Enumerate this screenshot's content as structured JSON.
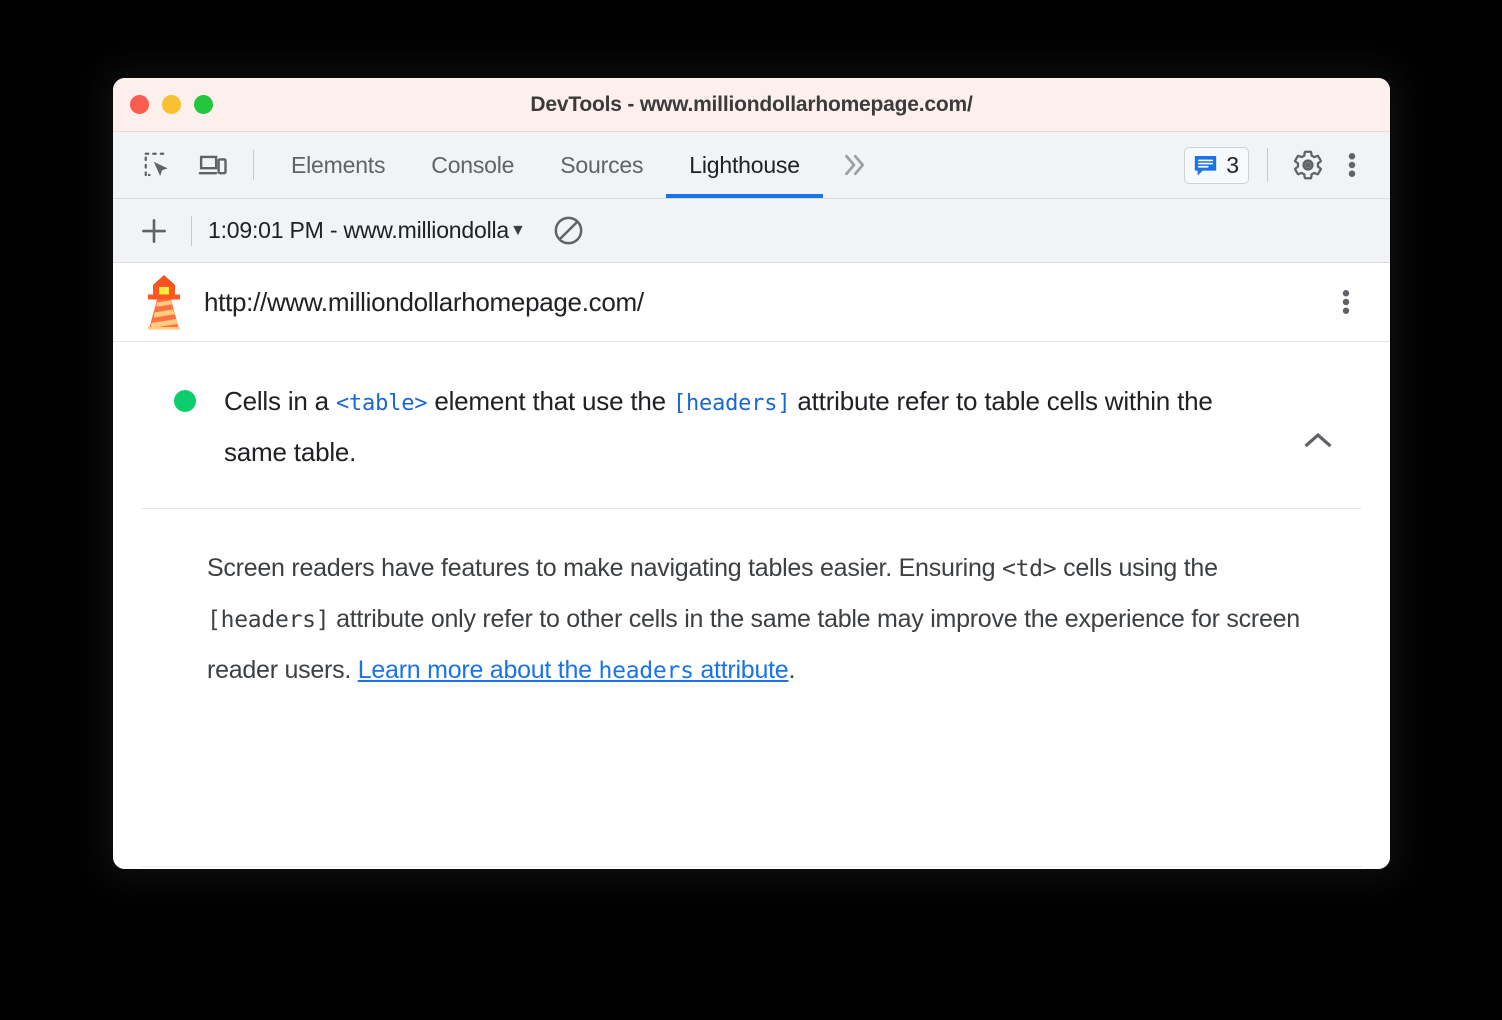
{
  "window": {
    "title": "DevTools - www.milliondollarhomepage.com/",
    "traffic_lights": [
      "close",
      "minimize",
      "maximize"
    ]
  },
  "tabbar": {
    "inspect_icon": "inspect-element-icon",
    "device_icon": "device-toolbar-icon",
    "tabs": [
      {
        "label": "Elements",
        "active": false
      },
      {
        "label": "Console",
        "active": false
      },
      {
        "label": "Sources",
        "active": false
      },
      {
        "label": "Lighthouse",
        "active": true
      }
    ],
    "more_tabs_icon": "chevron-double-right-icon",
    "issues": {
      "icon": "issues-speech-bubble-icon",
      "count": "3"
    },
    "settings_icon": "gear-icon",
    "menu_icon": "vertical-dots-icon",
    "active_tab_color": "#1a73e8"
  },
  "runbar": {
    "add_icon": "plus-icon",
    "run_label": "1:09:01 PM - www.milliondolla",
    "caret_icon": "triangle-down-icon",
    "clear_icon": "no-entry-clear-icon"
  },
  "report": {
    "logo_icon": "lighthouse-icon",
    "url": "http://www.milliondollarhomepage.com/",
    "menu_icon": "vertical-dots-icon"
  },
  "audit": {
    "status_color": "#0cce6b",
    "status_dot": "passed-green-dot",
    "title_part1": "Cells in a ",
    "title_code1": "<table>",
    "title_part2": " element that use the ",
    "title_code2": "[headers]",
    "title_part3": " attribute refer to table cells within the same table.",
    "collapse_icon": "chevron-up-icon",
    "desc_part1": "Screen readers have features to make navigating tables easier. Ensuring ",
    "desc_code1": "<td>",
    "desc_part2": " cells using the ",
    "desc_code2": "[headers]",
    "desc_part3": " attribute only refer to other cells in the same table may improve the experience for screen reader users. ",
    "link_text1": "Learn more about the ",
    "link_code": "headers",
    "link_text2": " attribute",
    "desc_part4": "."
  }
}
